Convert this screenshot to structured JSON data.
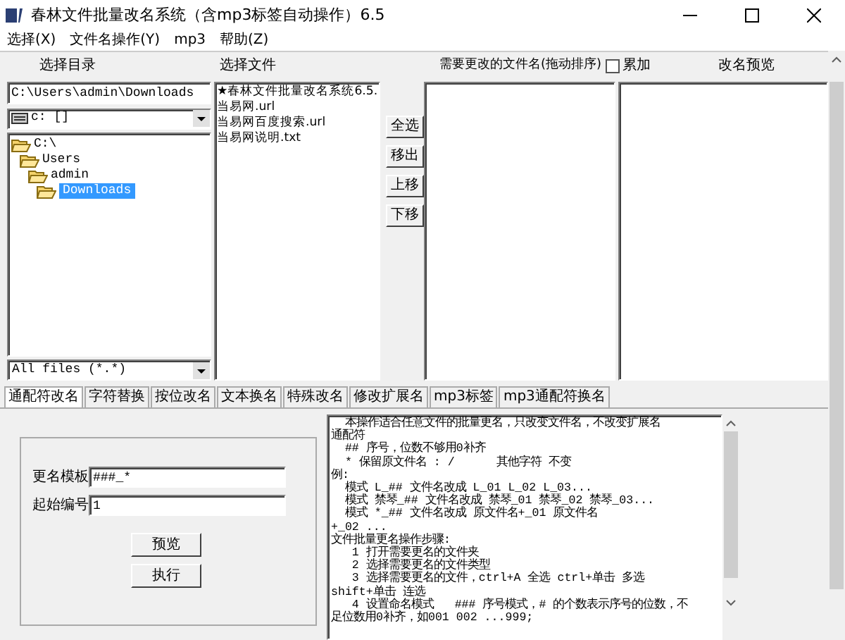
{
  "window": {
    "title": "春林文件批量改名系统（含mp3标签自动操作）6.5"
  },
  "menu": [
    "选择(X)",
    "文件名操作(Y)",
    "mp3",
    "帮助(Z)"
  ],
  "headers": {
    "directory": "选择目录",
    "files": "选择文件",
    "changes": "需要更改的文件名(拖动排序)",
    "accumulate": {
      "label": "累加",
      "checked": false
    },
    "preview": "改名预览"
  },
  "path": "C:\\Users\\admin\\Downloads",
  "drive": "c: []",
  "tree": [
    {
      "label": "C:\\",
      "selected": false,
      "children": [
        {
          "label": "Users",
          "selected": false,
          "children": [
            {
              "label": "admin",
              "selected": false,
              "children": [
                {
                  "label": "Downloads",
                  "selected": true
                }
              ]
            }
          ]
        }
      ]
    }
  ],
  "filter": "All files (*.*)",
  "files": [
    "★春林文件批量改名系统6.5.",
    "当易网.url",
    "当易网百度搜索.url",
    "当易网说明.txt"
  ],
  "side_buttons": [
    "全选",
    "移出",
    "上移",
    "下移"
  ],
  "tabs": [
    {
      "label": "通配符改名",
      "selected": true
    },
    {
      "label": "字符替换",
      "selected": false
    },
    {
      "label": "按位改名",
      "selected": false
    },
    {
      "label": "文本换名",
      "selected": false
    },
    {
      "label": "特殊改名",
      "selected": false
    },
    {
      "label": "修改扩展名",
      "selected": false
    },
    {
      "label": "mp3标签",
      "selected": false
    },
    {
      "label": "mp3通配符换名",
      "selected": false
    }
  ],
  "form": {
    "template_label": "更名模板",
    "template_value": "###_*",
    "start_label": "起始编号",
    "start_value": "1",
    "buttons": [
      "预览",
      "执行"
    ]
  },
  "help_lines": [
    "  本操作适合任意文件的批量更名，只改变文件名，不改变扩展名",
    "通配符",
    "  ## 序号，位数不够用0补齐",
    "  * 保留原文件名 : /      其他字符 不变",
    "例:",
    "  模式 L_## 文件名改成 L_01 L_02 L_03...",
    "  模式 禁琴_## 文件名改成 禁琴_01 禁琴_02 禁琴_03...",
    "  模式 *_## 文件名改成 原文件名+_01 原文件名",
    "+_02 ...",
    "文件批量更名操作步骤:",
    "   1 打开需要更名的文件夹",
    "   2 选择需要更名的文件类型",
    "   3 选择需要更名的文件，ctrl+A 全选 ctrl+单击 多选",
    "shift+单击 连选",
    "   4 设置命名模式   ### 序号模式，# 的个数表示序号的位数，不",
    "足位数用0补齐，如001 002 ...999;"
  ]
}
